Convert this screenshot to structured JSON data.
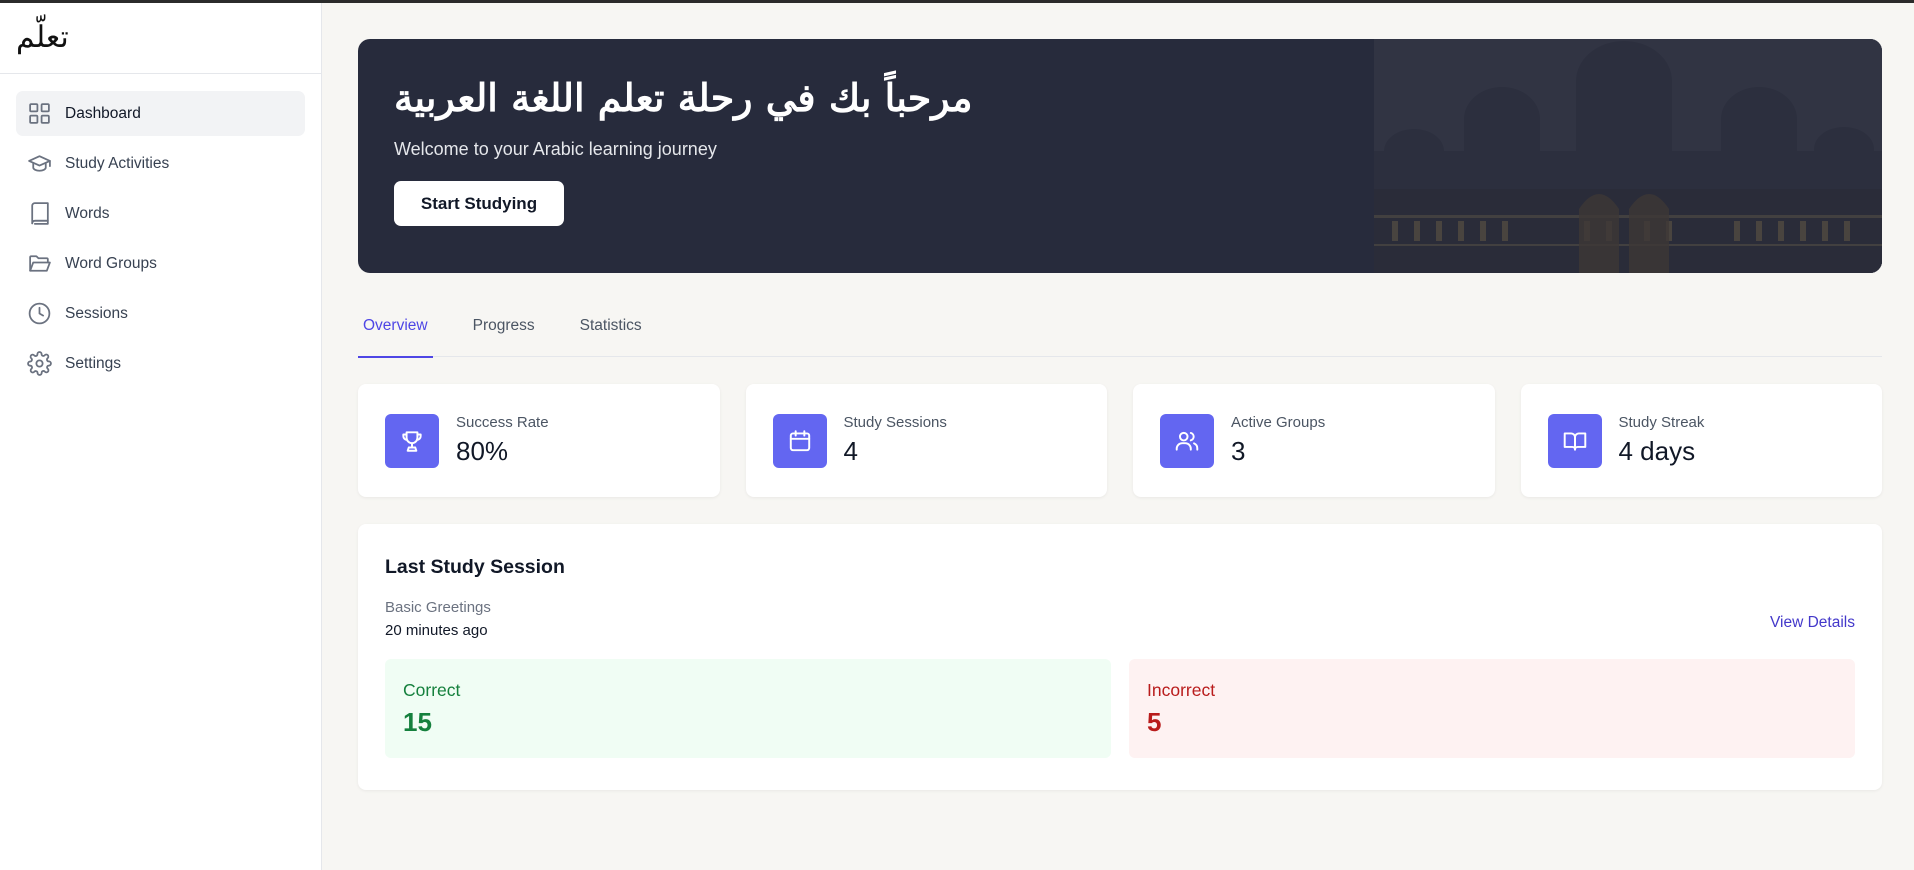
{
  "app": {
    "logo_text": "تعلّم"
  },
  "sidebar": {
    "items": [
      {
        "label": "Dashboard",
        "icon": "grid-icon",
        "active": true
      },
      {
        "label": "Study Activities",
        "icon": "graduation-cap-icon"
      },
      {
        "label": "Words",
        "icon": "book-icon"
      },
      {
        "label": "Word Groups",
        "icon": "folder-open-icon"
      },
      {
        "label": "Sessions",
        "icon": "clock-icon"
      },
      {
        "label": "Settings",
        "icon": "gear-icon"
      }
    ]
  },
  "hero": {
    "title": "مرحباً بك في رحلة تعلم اللغة العربية",
    "subtitle": "Welcome to your Arabic learning journey",
    "button_label": "Start Studying",
    "image_icon": "mosque-image"
  },
  "tabs": [
    {
      "label": "Overview",
      "active": true
    },
    {
      "label": "Progress"
    },
    {
      "label": "Statistics"
    }
  ],
  "stats": [
    {
      "label": "Success Rate",
      "value": "80%",
      "icon": "trophy-icon"
    },
    {
      "label": "Study Sessions",
      "value": "4",
      "icon": "calendar-icon"
    },
    {
      "label": "Active Groups",
      "value": "3",
      "icon": "users-icon"
    },
    {
      "label": "Study Streak",
      "value": "4 days",
      "icon": "book-open-icon"
    }
  ],
  "last_session": {
    "title": "Last Study Session",
    "group": "Basic Greetings",
    "time": "20 minutes ago",
    "view_details": "View Details",
    "correct_label": "Correct",
    "correct_value": "15",
    "incorrect_label": "Incorrect",
    "incorrect_value": "5"
  },
  "colors": {
    "accent": "#6366f1",
    "tab_active": "#4f46e5",
    "hero_bg": "#272b3c",
    "correct": "#15803d",
    "incorrect": "#b91c1c"
  }
}
